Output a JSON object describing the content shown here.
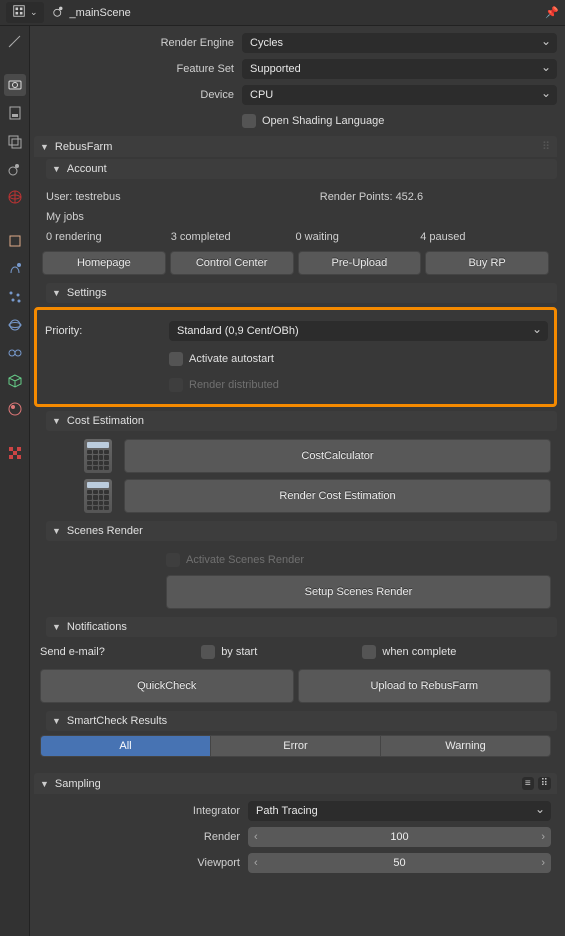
{
  "header": {
    "scene_name": "_mainScene"
  },
  "render": {
    "engine_label": "Render Engine",
    "engine_value": "Cycles",
    "feature_label": "Feature Set",
    "feature_value": "Supported",
    "device_label": "Device",
    "device_value": "CPU",
    "osl_label": "Open Shading Language"
  },
  "rebus": {
    "title": "RebusFarm",
    "account": {
      "title": "Account",
      "user_label": "User: testrebus",
      "points_label": "Render Points: 452.6",
      "jobs_title": "My jobs",
      "rendering": "0 rendering",
      "completed": "3 completed",
      "waiting": "0 waiting",
      "paused": "4 paused",
      "btn_homepage": "Homepage",
      "btn_control": "Control Center",
      "btn_preupload": "Pre-Upload",
      "btn_buy": "Buy RP"
    },
    "settings": {
      "title": "Settings",
      "priority_label": "Priority:",
      "priority_value": "Standard (0,9 Cent/OBh)",
      "autostart_label": "Activate autostart",
      "distributed_label": "Render distributed"
    },
    "cost": {
      "title": "Cost Estimation",
      "btn_calc": "CostCalculator",
      "btn_est": "Render Cost Estimation"
    },
    "scenes": {
      "title": "Scenes Render",
      "activate_label": "Activate Scenes Render",
      "btn_setup": "Setup Scenes Render"
    },
    "notif": {
      "title": "Notifications",
      "email_label": "Send e-mail?",
      "start_label": "by start",
      "complete_label": "when complete",
      "btn_quick": "QuickCheck",
      "btn_upload": "Upload to RebusFarm"
    },
    "smart": {
      "title": "SmartCheck Results",
      "all": "All",
      "error": "Error",
      "warning": "Warning"
    }
  },
  "sampling": {
    "title": "Sampling",
    "integrator_label": "Integrator",
    "integrator_value": "Path Tracing",
    "render_label": "Render",
    "render_value": "100",
    "viewport_label": "Viewport",
    "viewport_value": "50"
  }
}
